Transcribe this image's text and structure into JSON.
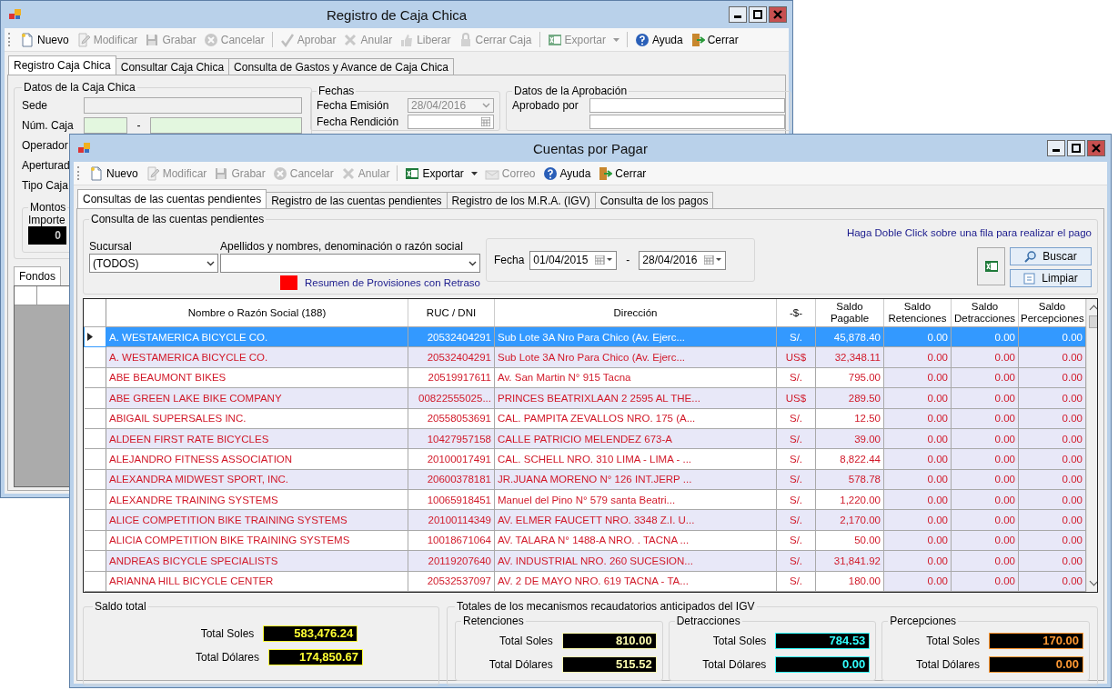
{
  "back_window": {
    "title": "Registro de Caja Chica",
    "toolbar": [
      {
        "label": "Nuevo",
        "disabled": false,
        "separator": false
      },
      {
        "label": "Modificar",
        "disabled": true,
        "separator": false
      },
      {
        "label": "Grabar",
        "disabled": true,
        "separator": false
      },
      {
        "label": "Cancelar",
        "disabled": true,
        "separator": true
      },
      {
        "label": "Aprobar",
        "disabled": true,
        "separator": false
      },
      {
        "label": "Anular",
        "disabled": true,
        "separator": false
      },
      {
        "label": "Liberar",
        "disabled": true,
        "separator": false
      },
      {
        "label": "Cerrar Caja",
        "disabled": true,
        "separator": true
      },
      {
        "label": "Exportar",
        "disabled": true,
        "separator": true,
        "dropdown": true
      },
      {
        "label": "Ayuda",
        "disabled": false,
        "separator": false
      },
      {
        "label": "Cerrar",
        "disabled": false,
        "separator": false
      }
    ],
    "tabs": [
      {
        "label": "Registro Caja Chica",
        "selected": true
      },
      {
        "label": "Consultar Caja Chica",
        "selected": false
      },
      {
        "label": "Consulta de Gastos y Avance de Caja Chica",
        "selected": false
      }
    ],
    "caja_group": {
      "title": "Datos de la Caja Chica",
      "fields": [
        {
          "label": "Sede",
          "kind": "text"
        },
        {
          "label": "Núm. Caja",
          "kind": "split",
          "separator": "-"
        },
        {
          "label": "Operador",
          "kind": "label"
        },
        {
          "label": "Aperturad",
          "kind": "label"
        },
        {
          "label": "Tipo Caja",
          "kind": "label"
        }
      ]
    },
    "montos": {
      "title": "Montos",
      "label": "Importe",
      "value": "0"
    },
    "lower_tabs": [
      {
        "label": "Fondos",
        "selected": true
      }
    ],
    "fechas": {
      "title": "Fechas",
      "fields": [
        {
          "label": "Fecha Emisión",
          "value": "28/04/2016",
          "disabled": true,
          "kind": "combo"
        },
        {
          "label": "Fecha Rendición",
          "kind": "date"
        }
      ]
    },
    "aprobacion": {
      "title": "Datos de la Aprobación",
      "fields": [
        {
          "label": "Aprobado por"
        }
      ]
    }
  },
  "front_window": {
    "title": "Cuentas por Pagar",
    "toolbar": [
      {
        "label": "Nuevo",
        "disabled": false,
        "separator": false
      },
      {
        "label": "Modificar",
        "disabled": true,
        "separator": false
      },
      {
        "label": "Grabar",
        "disabled": true,
        "separator": false
      },
      {
        "label": "Cancelar",
        "disabled": true,
        "separator": false
      },
      {
        "label": "Anular",
        "disabled": true,
        "separator": true
      },
      {
        "label": "Exportar",
        "disabled": false,
        "separator": false,
        "dropdown": true
      },
      {
        "label": "Correo",
        "disabled": true,
        "separator": false
      },
      {
        "label": "Ayuda",
        "disabled": false,
        "separator": false
      },
      {
        "label": "Cerrar",
        "disabled": false,
        "separator": false
      }
    ],
    "tabs": [
      {
        "label": "Consultas de las cuentas pendientes",
        "selected": true
      },
      {
        "label": "Registro de las cuentas pendientes",
        "selected": false
      },
      {
        "label": "Registro de los M.R.A. (IGV)",
        "selected": false
      },
      {
        "label": "Consulta de los pagos",
        "selected": false
      }
    ],
    "filters": {
      "title": "Consulta de las cuentas pendientes",
      "sucursal": {
        "label": "Sucursal",
        "value": "(TODOS)"
      },
      "proveedor": {
        "label": "Apellidos y nombres, denominación o razón social"
      },
      "legend": "Resumen de Provisiones con Retraso",
      "fecha": {
        "label": "Fecha",
        "from": "01/04/2015",
        "separator": "-",
        "to": "28/04/2016"
      },
      "hint": "Haga Doble Click sobre una fila para realizar el pago",
      "buttons": [
        "Buscar",
        "Limpiar"
      ]
    },
    "table": {
      "columns": [
        "Nombre o Razón Social (188)",
        "RUC / DNI",
        "Dirección",
        "-$-",
        "Saldo Pagable",
        "Saldo Retenciones",
        "Saldo Detracciones",
        "Saldo Percepciones"
      ],
      "rows": [
        {
          "name": "A. WESTAMERICA BICYCLE CO.",
          "ruc": "20532404291",
          "address": "Sub Lote 3A Nro Para Chico (Av. Ejerc...",
          "currency": "S/.",
          "pagable": "45,878.40",
          "retenciones": "0.00",
          "detracciones": "0.00",
          "percepciones": "0.00",
          "selected": true
        },
        {
          "name": "A. WESTAMERICA BICYCLE CO.",
          "ruc": "20532404291",
          "address": "Sub Lote 3A Nro Para Chico (Av. Ejerc...",
          "currency": "US$",
          "pagable": "32,348.11",
          "retenciones": "0.00",
          "detracciones": "0.00",
          "percepciones": "0.00",
          "selected": false
        },
        {
          "name": "ABE BEAUMONT BIKES",
          "ruc": "20519917611",
          "address": "Av. San Martin N° 915 Tacna",
          "currency": "S/.",
          "pagable": "795.00",
          "retenciones": "0.00",
          "detracciones": "0.00",
          "percepciones": "0.00",
          "selected": false
        },
        {
          "name": "ABE GREEN LAKE BIKE COMPANY",
          "ruc": "00822555025...",
          "address": "PRINCES BEATRIXLAAN 2 2595 AL THE...",
          "currency": "US$",
          "pagable": "289.50",
          "retenciones": "0.00",
          "detracciones": "0.00",
          "percepciones": "0.00",
          "selected": false
        },
        {
          "name": "ABIGAIL SUPERSALES INC.",
          "ruc": "20558053691",
          "address": "CAL. PAMPITA ZEVALLOS NRO. 175 (A...",
          "currency": "S/.",
          "pagable": "12.50",
          "retenciones": "0.00",
          "detracciones": "0.00",
          "percepciones": "0.00",
          "selected": false
        },
        {
          "name": "ALDEEN FIRST RATE BICYCLES",
          "ruc": "10427957158",
          "address": "CALLE PATRICIO MELENDEZ 673-A",
          "currency": "S/.",
          "pagable": "39.00",
          "retenciones": "0.00",
          "detracciones": "0.00",
          "percepciones": "0.00",
          "selected": false
        },
        {
          "name": "ALEJANDRO FITNESS ASSOCIATION",
          "ruc": "20100017491",
          "address": "CAL. SCHELL NRO. 310 LIMA - LIMA - ...",
          "currency": "S/.",
          "pagable": "8,822.44",
          "retenciones": "0.00",
          "detracciones": "0.00",
          "percepciones": "0.00",
          "selected": false
        },
        {
          "name": "ALEXANDRA MIDWEST SPORT, INC.",
          "ruc": "20600378181",
          "address": "JR.JUANA MORENO N° 126  INT.JERP ...",
          "currency": "S/.",
          "pagable": "578.78",
          "retenciones": "0.00",
          "detracciones": "0.00",
          "percepciones": "0.00",
          "selected": false
        },
        {
          "name": "ALEXANDRE TRAINING SYSTEMS",
          "ruc": "10065918451",
          "address": "Manuel del Pino N° 579 santa Beatri...",
          "currency": "S/.",
          "pagable": "1,220.00",
          "retenciones": "0.00",
          "detracciones": "0.00",
          "percepciones": "0.00",
          "selected": false
        },
        {
          "name": "ALICE COMPETITION BIKE TRAINING SYSTEMS",
          "ruc": "20100114349",
          "address": "AV. ELMER FAUCETT NRO. 3348 Z.I. U...",
          "currency": "S/.",
          "pagable": "2,170.00",
          "retenciones": "0.00",
          "detracciones": "0.00",
          "percepciones": "0.00",
          "selected": false
        },
        {
          "name": "ALICIA COMPETITION BIKE TRAINING SYSTEMS",
          "ruc": "10018671064",
          "address": "AV. TALARA N° 1488-A NRO. . TACNA ...",
          "currency": "S/.",
          "pagable": "50.00",
          "retenciones": "0.00",
          "detracciones": "0.00",
          "percepciones": "0.00",
          "selected": false
        },
        {
          "name": "ANDREAS BICYCLE SPECIALISTS",
          "ruc": "20119207640",
          "address": "AV. INDUSTRIAL NRO. 260 SUCESION...",
          "currency": "S/.",
          "pagable": "31,841.92",
          "retenciones": "0.00",
          "detracciones": "0.00",
          "percepciones": "0.00",
          "selected": false
        },
        {
          "name": "ARIANNA HILL BICYCLE CENTER",
          "ruc": "20532537097",
          "address": "AV. 2 DE MAYO NRO. 619 TACNA - TA...",
          "currency": "S/.",
          "pagable": "180.00",
          "retenciones": "0.00",
          "detracciones": "0.00",
          "percepciones": "0.00",
          "selected": false
        }
      ]
    },
    "saldo_total": {
      "title": "Saldo total",
      "color": "#ffff33",
      "items": [
        {
          "label": "Total Soles",
          "value": "583,476.24"
        },
        {
          "label": "Total Dólares",
          "value": "174,850.67"
        }
      ]
    },
    "totales_igv": {
      "title": "Totales de los mecanismos recaudatorios anticipados del IGV",
      "groups": [
        {
          "title": "Retenciones",
          "color": "#ffffb0",
          "items": [
            {
              "label": "Total Soles",
              "value": "810.00"
            },
            {
              "label": "Total Dólares",
              "value": "515.52"
            }
          ]
        },
        {
          "title": "Detracciones",
          "color": "#33ffff",
          "items": [
            {
              "label": "Total Soles",
              "value": "784.53"
            },
            {
              "label": "Total Dólares",
              "value": "0.00"
            }
          ]
        },
        {
          "title": "Percepciones",
          "color": "#ff9933",
          "items": [
            {
              "label": "Total Soles",
              "value": "170.00"
            },
            {
              "label": "Total Dólares",
              "value": "0.00"
            }
          ]
        }
      ]
    }
  }
}
